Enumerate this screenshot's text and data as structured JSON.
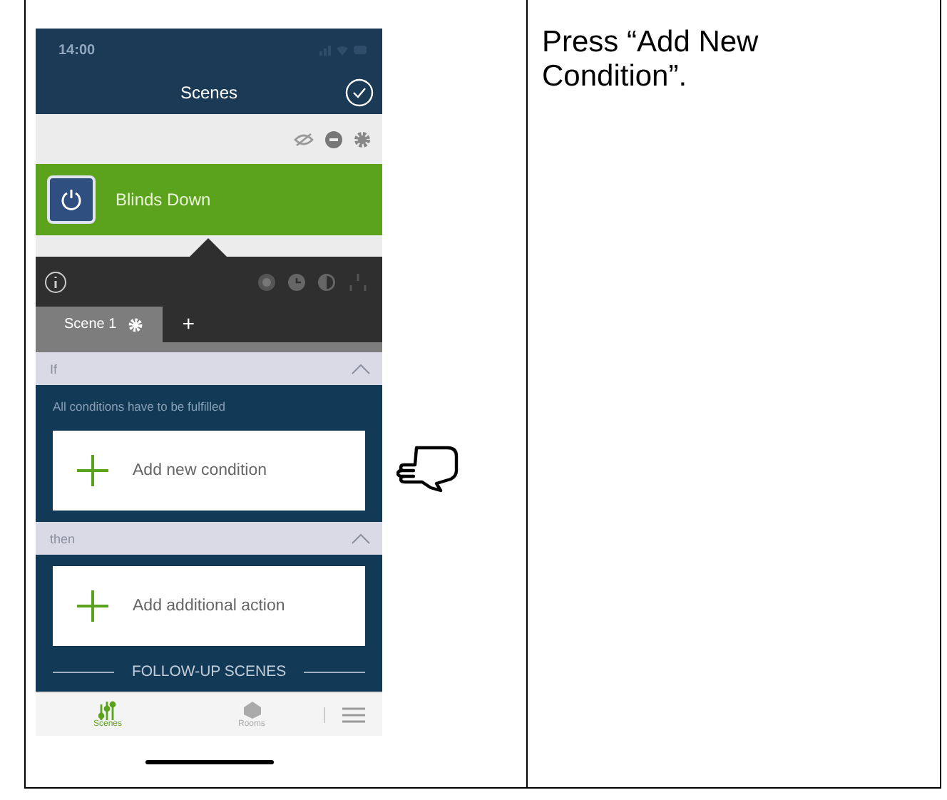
{
  "instruction": "Press “Add New Condition”.",
  "phone": {
    "time": "14:00",
    "title": "Scenes",
    "scene": {
      "name": "Blinds Down"
    },
    "tabs": [
      {
        "label": "Scene 1",
        "selected": true
      },
      {
        "label": "+",
        "selected": false
      }
    ],
    "sections": [
      {
        "header": "If",
        "note": "All conditions have to be fulfilled",
        "action": "Add new condition"
      },
      {
        "header": "then",
        "action": "Add additional action",
        "footer": "FOLLOW-UP SCENES"
      }
    ],
    "nav": [
      {
        "label": "Scenes",
        "selected": true
      },
      {
        "label": "Rooms",
        "selected": false
      }
    ]
  }
}
